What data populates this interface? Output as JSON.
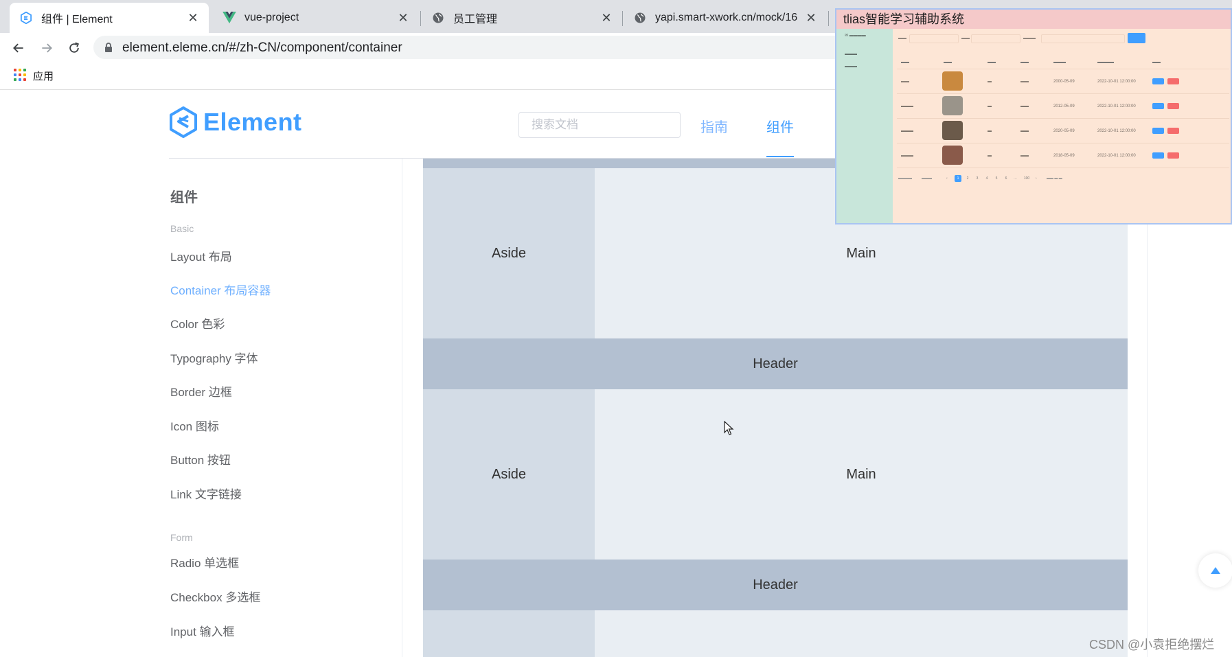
{
  "browser": {
    "tabs": [
      {
        "title": "组件 | Element",
        "active": true
      },
      {
        "title": "vue-project",
        "active": false
      },
      {
        "title": "员工管理",
        "active": false
      },
      {
        "title": "yapi.smart-xwork.cn/mock/16",
        "active": false
      }
    ],
    "url": "element.eleme.cn/#/zh-CN/component/container",
    "bookmark_apps_label": "应用"
  },
  "site": {
    "brand": "Element",
    "brand_color": "#409eff",
    "search_placeholder": "搜索文档",
    "nav": {
      "guide": "指南",
      "component": "组件"
    }
  },
  "sidebar": {
    "title": "组件",
    "groups": [
      {
        "label": "Basic",
        "items": [
          "Layout 布局",
          "Container 布局容器",
          "Color 色彩",
          "Typography 字体",
          "Border 边框",
          "Icon 图标",
          "Button 按钮",
          "Link 文字链接"
        ]
      },
      {
        "label": "Form",
        "items": [
          "Radio 单选框",
          "Checkbox 多选框",
          "Input 输入框"
        ]
      }
    ],
    "active_item": "Container 布局容器"
  },
  "demo": {
    "aside_1": "Aside",
    "main_1": "Main",
    "header_1": "Header",
    "aside_2": "Aside",
    "main_2": "Main",
    "header_2": "Header",
    "colors": {
      "header": "#b3c0d1",
      "aside": "#d3dce6",
      "main": "#e9eef3"
    }
  },
  "overlay": {
    "title": "tlias智能学习辅助系统",
    "rows": [
      {
        "date": "2000-05-09",
        "time": "2022-10-01 12:00:00"
      },
      {
        "date": "2012-05-09",
        "time": "2022-10-01 12:00:00"
      },
      {
        "date": "2020-05-09",
        "time": "2022-10-01 12:00:00"
      },
      {
        "date": "2018-05-09",
        "time": "2022-10-01 12:00:00"
      }
    ],
    "pages": [
      "1",
      "2",
      "3",
      "4",
      "5",
      "6",
      "100"
    ]
  },
  "watermark": "CSDN @小袁拒绝摆烂"
}
